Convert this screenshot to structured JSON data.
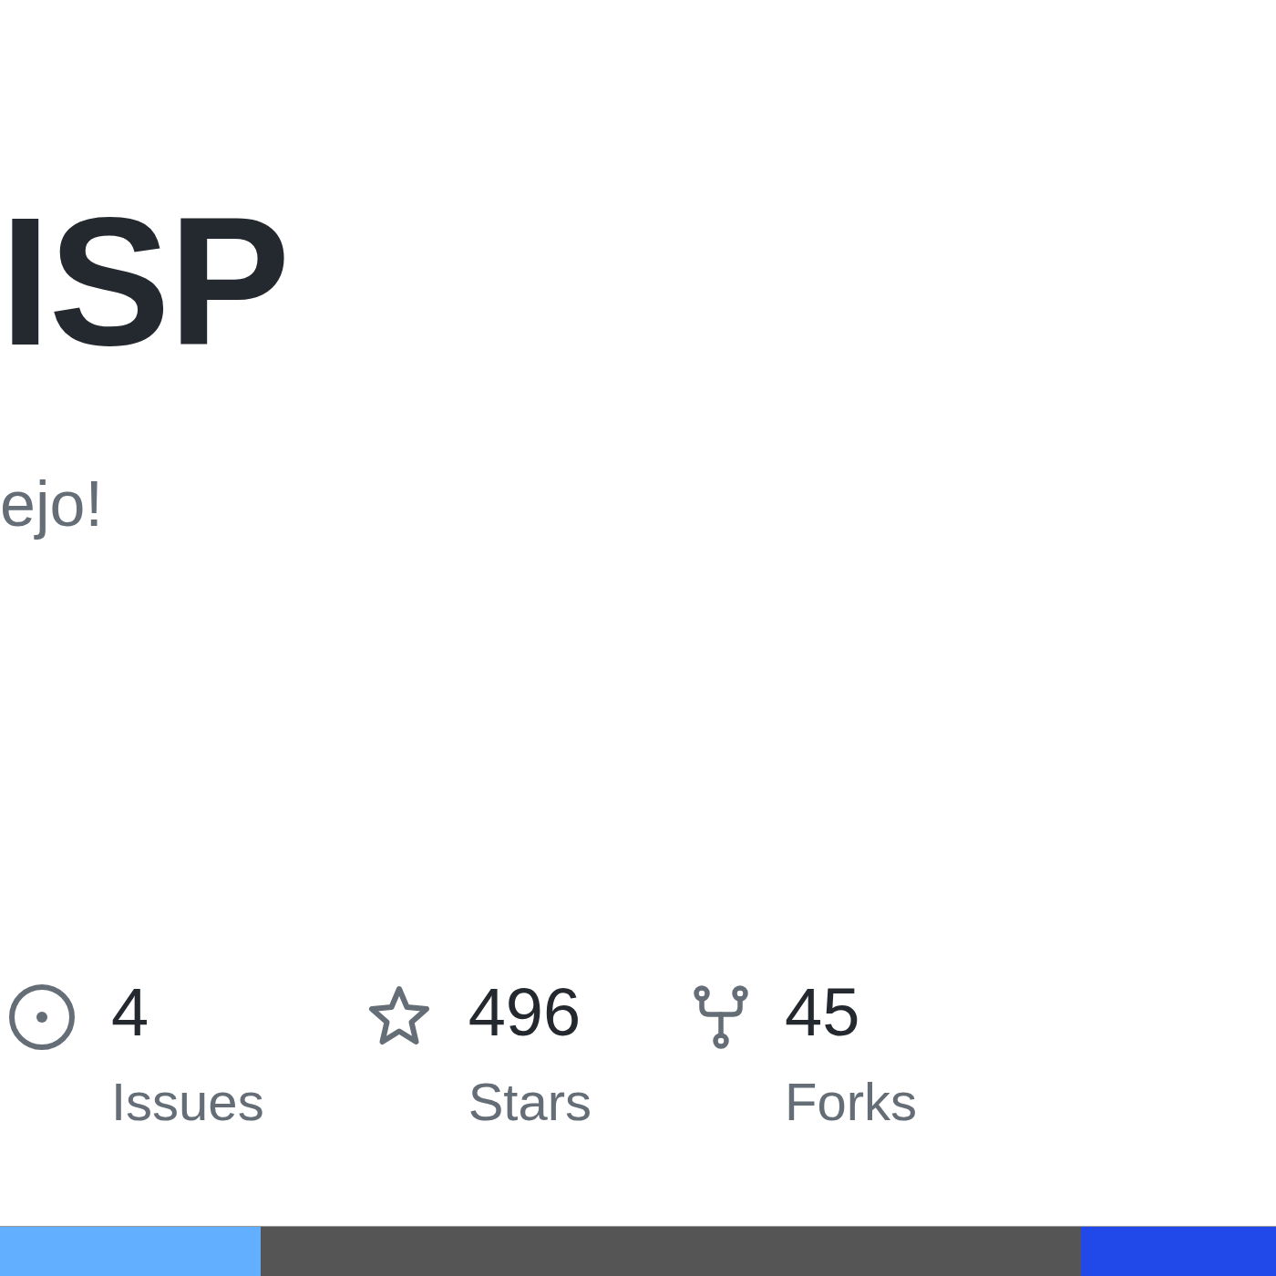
{
  "title": "ISP",
  "description": "ejo!",
  "stats": [
    {
      "kind": "issues",
      "count": "4",
      "label": "Issues"
    },
    {
      "kind": "stars",
      "count": "496",
      "label": "Stars"
    },
    {
      "kind": "forks",
      "count": "45",
      "label": "Forks"
    }
  ],
  "language_bar": [
    {
      "color": "#62aeff",
      "level": 0.204
    },
    {
      "color": "#555555"
    },
    {
      "color": "#2148e8",
      "level": 0.153
    }
  ]
}
